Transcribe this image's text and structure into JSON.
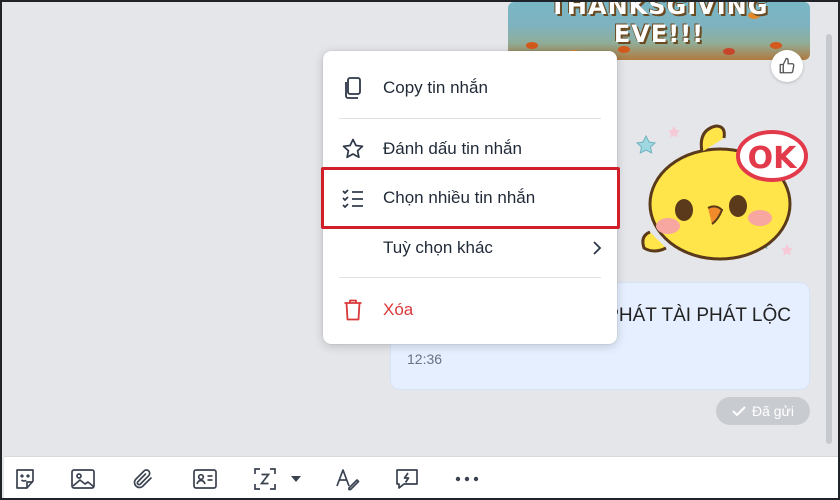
{
  "messages": {
    "gif_line1": "THANKSGIVING",
    "gif_line2": "EVE!!!",
    "sticker_text": "OK",
    "text_message": "PHÁT TÀI PHÁT LỘC",
    "time": "12:36",
    "status": "Đã gửi"
  },
  "context_menu": {
    "items": [
      {
        "label": "Copy tin nhắn",
        "icon": "copy-icon"
      },
      {
        "label": "Đánh dấu tin nhắn",
        "icon": "star-icon"
      },
      {
        "label": "Chọn nhiều tin nhắn",
        "icon": "multi-select-list-icon"
      },
      {
        "label": "Tuỳ chọn khác",
        "icon": "none"
      },
      {
        "label": "Xóa",
        "icon": "trash-icon"
      }
    ],
    "highlighted_item": "Chọn nhiều tin nhắn"
  },
  "toolbar": {
    "buttons": [
      {
        "icon": "sticker-icon"
      },
      {
        "icon": "image-icon"
      },
      {
        "icon": "attachment-icon"
      },
      {
        "icon": "contact-card-icon"
      },
      {
        "icon": "screenshot-icon"
      },
      {
        "icon": "chevron-down-icon"
      },
      {
        "icon": "text-format-icon"
      },
      {
        "icon": "quick-message-icon"
      },
      {
        "icon": "more-icon"
      }
    ]
  },
  "colors": {
    "highlight": "#d11f2a",
    "danger": "#d93838",
    "bubble": "#e5efff",
    "background": "#e4e6ea"
  }
}
